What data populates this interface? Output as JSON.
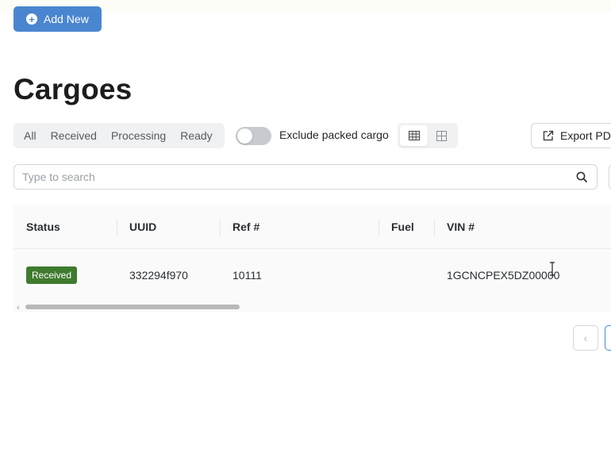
{
  "toolbar": {
    "add_new_label": "Add New"
  },
  "page": {
    "title": "Cargoes"
  },
  "filters": {
    "tabs": [
      {
        "label": "All"
      },
      {
        "label": "Received"
      },
      {
        "label": "Processing"
      },
      {
        "label": "Ready"
      }
    ],
    "exclude_packed_label": "Exclude packed cargo",
    "exclude_packed_on": false
  },
  "view": {
    "active": "table-view"
  },
  "export": {
    "label": "Export PDF"
  },
  "search": {
    "placeholder": "Type to search",
    "value": ""
  },
  "table": {
    "columns": [
      "Status",
      "UUID",
      "Ref #",
      "Fuel",
      "VIN #"
    ],
    "rows": [
      {
        "status": "Received",
        "uuid": "332294f970",
        "ref": "10111",
        "fuel": "",
        "vin": "1GCNCPEX5DZ00000"
      }
    ]
  },
  "colors": {
    "accent": "#4a86d0",
    "status_received": "#3f7a2e"
  }
}
